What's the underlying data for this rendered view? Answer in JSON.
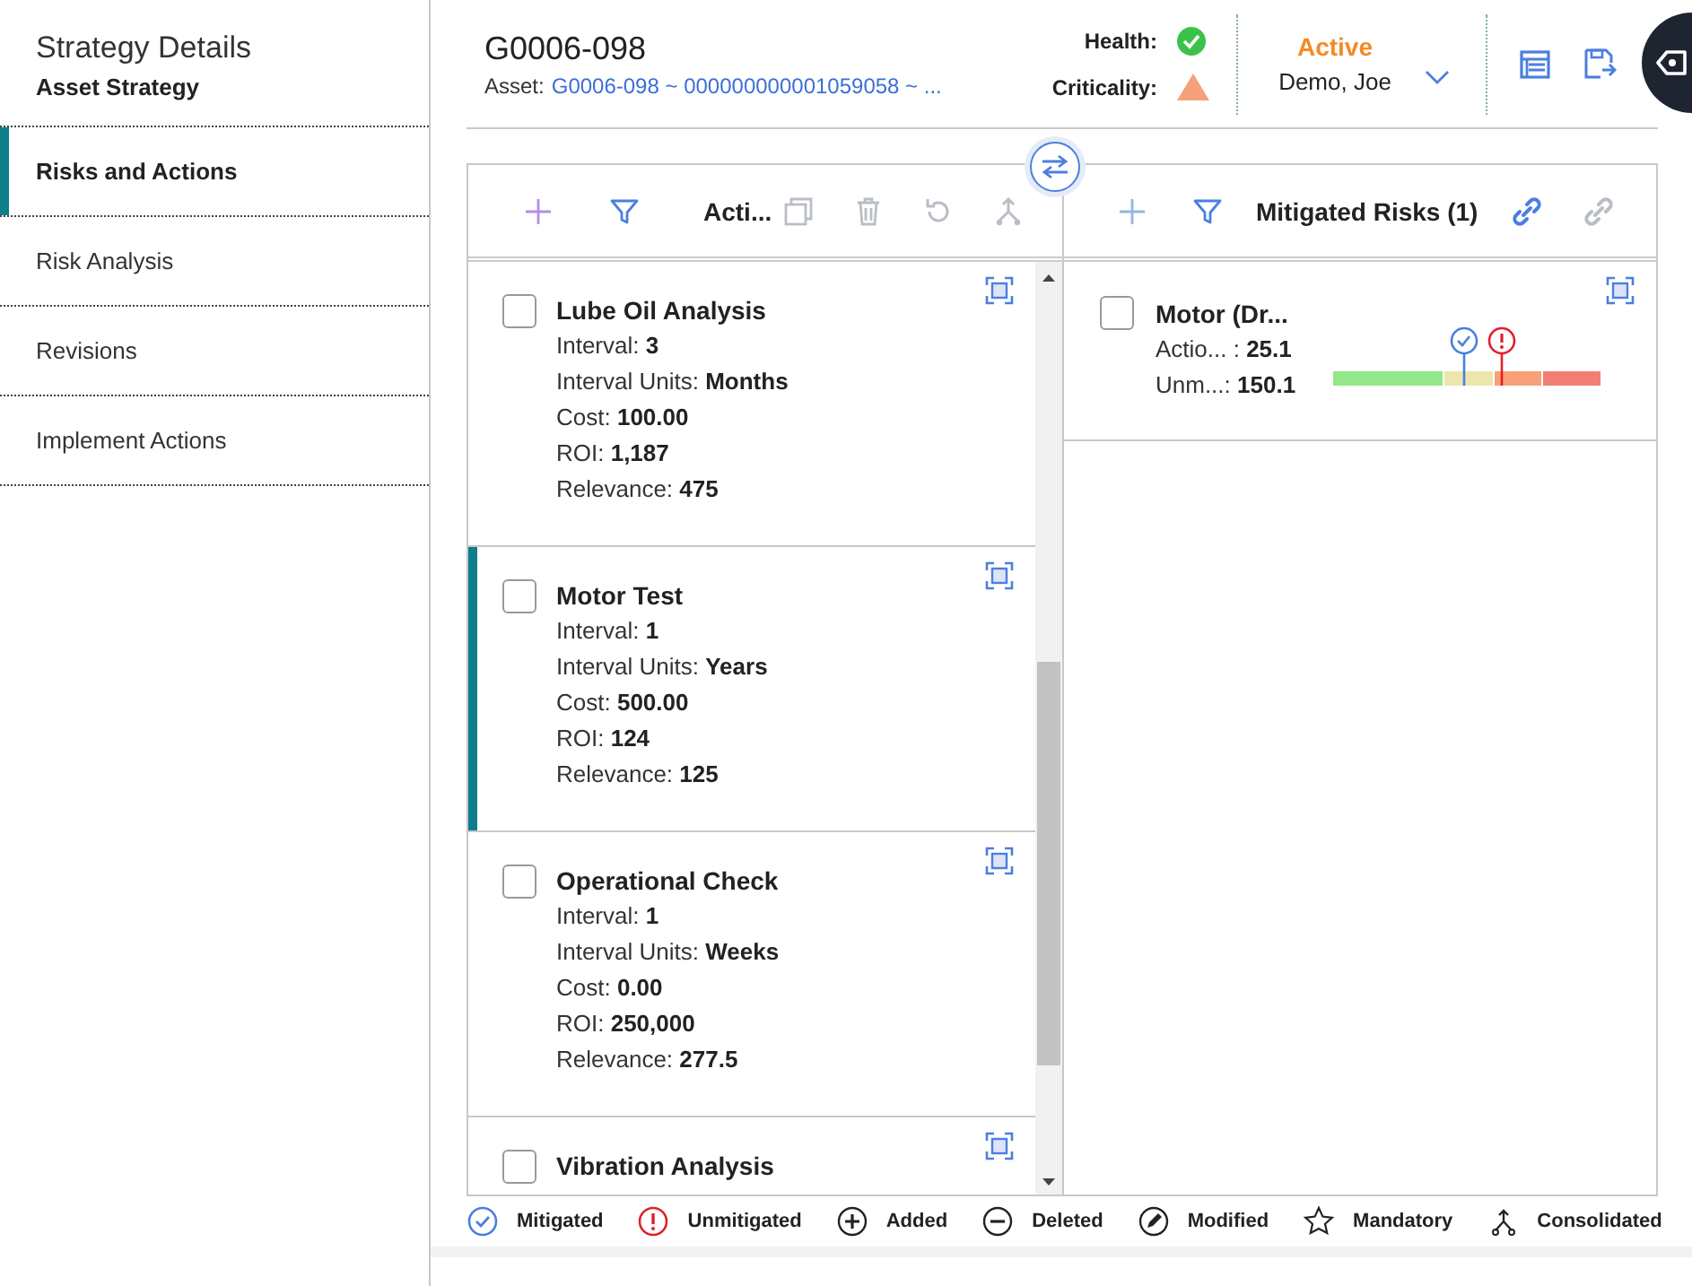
{
  "sidebar": {
    "title": "Strategy Details",
    "subtitle": "Asset Strategy",
    "items": [
      {
        "label": "Risks and Actions",
        "selected": true
      },
      {
        "label": "Risk Analysis",
        "selected": false
      },
      {
        "label": "Revisions",
        "selected": false
      },
      {
        "label": "Implement Actions",
        "selected": false
      }
    ]
  },
  "header": {
    "title": "G0006-098",
    "asset_label": "Asset:",
    "asset_link": "G0006-098 ~ 000000000001059058 ~ ...",
    "health_label": "Health:",
    "criticality_label": "Criticality:",
    "status": "Active",
    "owner": "Demo, Joe"
  },
  "actions_panel": {
    "title": "Acti...",
    "cards": [
      {
        "name": "Lube Oil Analysis",
        "checked": false,
        "selected": false,
        "fields": [
          {
            "label": "Interval:",
            "value": "3"
          },
          {
            "label": "Interval Units:",
            "value": "Months"
          },
          {
            "label": "Cost:",
            "value": "100.00"
          },
          {
            "label": "ROI:",
            "value": "1,187"
          },
          {
            "label": "Relevance:",
            "value": "475"
          }
        ]
      },
      {
        "name": "Motor Test",
        "checked": false,
        "selected": true,
        "fields": [
          {
            "label": "Interval:",
            "value": "1"
          },
          {
            "label": "Interval Units:",
            "value": "Years"
          },
          {
            "label": "Cost:",
            "value": "500.00"
          },
          {
            "label": "ROI:",
            "value": "124"
          },
          {
            "label": "Relevance:",
            "value": "125"
          }
        ]
      },
      {
        "name": "Operational Check",
        "checked": false,
        "selected": false,
        "fields": [
          {
            "label": "Interval:",
            "value": "1"
          },
          {
            "label": "Interval Units:",
            "value": "Weeks"
          },
          {
            "label": "Cost:",
            "value": "0.00"
          },
          {
            "label": "ROI:",
            "value": "250,000"
          },
          {
            "label": "Relevance:",
            "value": "277.5"
          }
        ]
      },
      {
        "name": "Vibration Analysis",
        "checked": false,
        "selected": false
      }
    ]
  },
  "risks_panel": {
    "title": "Mitigated Risks (1)",
    "risks": [
      {
        "name": "Motor (Dr...",
        "checked": false,
        "fields": [
          {
            "label": "Actio... :",
            "value": "25.1"
          },
          {
            "label": "Unm...:",
            "value": "150.1"
          }
        ]
      }
    ]
  },
  "legend": [
    {
      "kind": "mitigated",
      "label": "Mitigated"
    },
    {
      "kind": "unmitigated",
      "label": "Unmitigated"
    },
    {
      "kind": "added",
      "label": "Added"
    },
    {
      "kind": "deleted",
      "label": "Deleted"
    },
    {
      "kind": "modified",
      "label": "Modified"
    },
    {
      "kind": "mandatory",
      "label": "Mandatory"
    },
    {
      "kind": "consolidated",
      "label": "Consolidated"
    }
  ]
}
